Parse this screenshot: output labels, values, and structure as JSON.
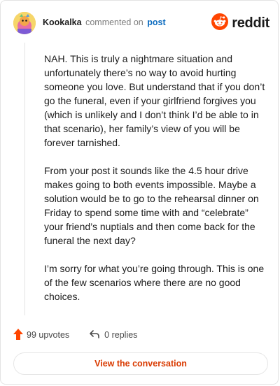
{
  "header": {
    "username": "Kookalka",
    "action": "commented on",
    "link": "post",
    "logo_text": "reddit"
  },
  "comment": {
    "paragraphs": [
      "NAH. This is truly a nightmare situation and unfortunately there’s no way to avoid hurting someone you love. But understand that if you don’t go the funeral, even if your girlfriend forgives you (which is unlikely and I don’t think I’d be able to in that scenario), her family’s view of you will be forever tarnished.",
      "From your post it sounds like the 4.5 hour drive makes going to both events impossible. Maybe a solution would be to go to the rehearsal dinner on Friday to spend some time with and “celebrate” your friend’s nuptials and then come back for the funeral the next day?",
      "I’m sorry for what you’re going through. This is one of the few scenarios where there are no good choices."
    ]
  },
  "footer": {
    "upvotes": "99 upvotes",
    "replies": "0 replies",
    "view_button": "View the conversation"
  },
  "colors": {
    "accent": "#ff4500",
    "link": "#0b6bbf",
    "button_text": "#d93a00"
  },
  "icons": {
    "upvote": "upvote-arrow-icon",
    "reply": "reply-arrow-icon",
    "logo": "reddit-snoo-icon"
  }
}
